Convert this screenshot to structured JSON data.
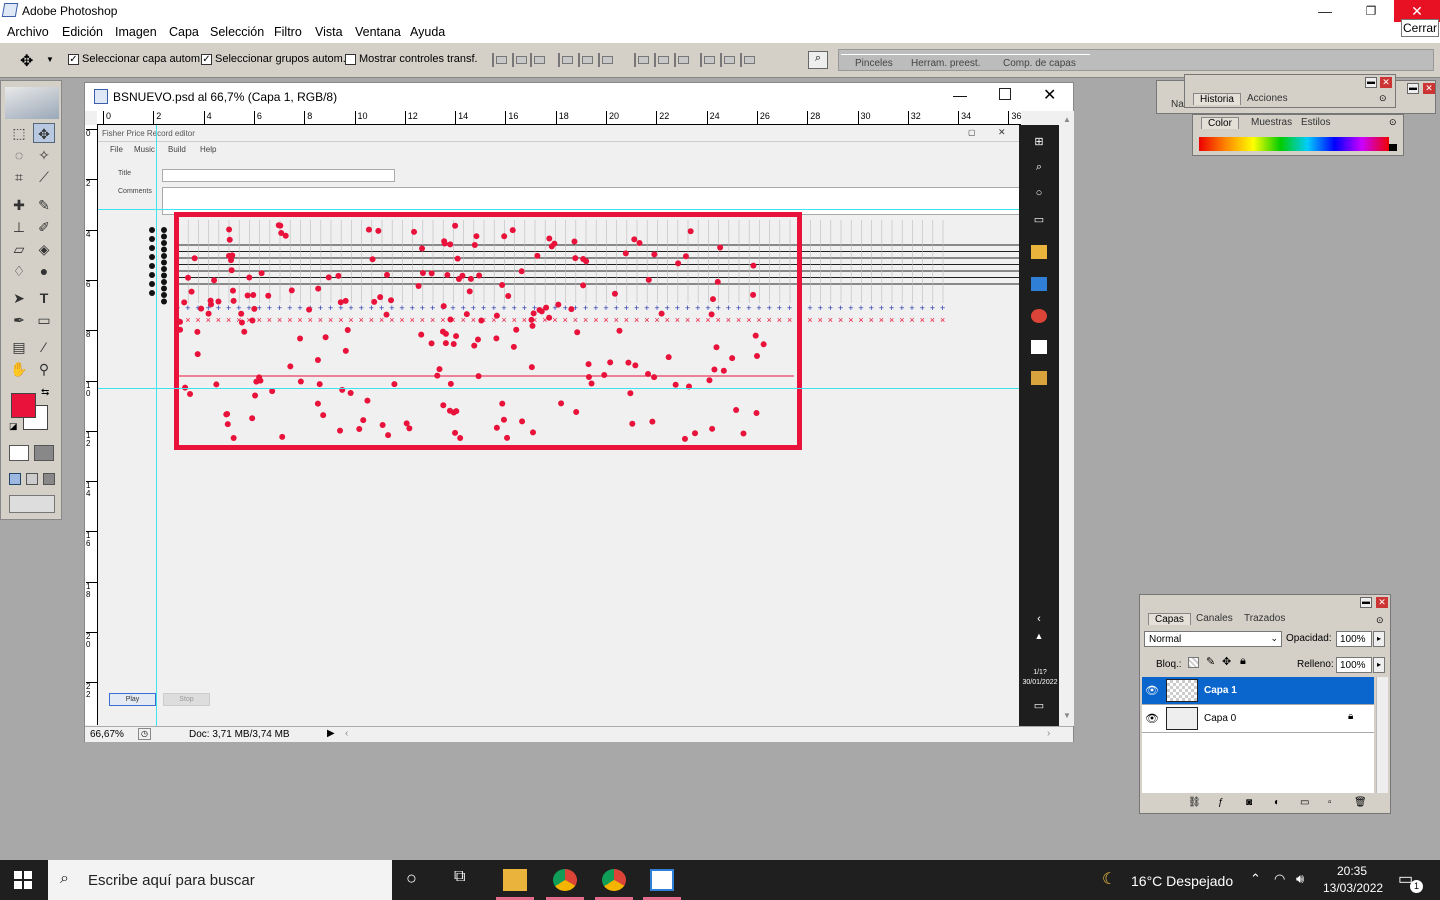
{
  "app": {
    "title": "Adobe Photoshop",
    "close_tooltip": "Cerrar",
    "minimize": "—",
    "restore": "❐",
    "close": "✕"
  },
  "menu": [
    "Archivo",
    "Edición",
    "Imagen",
    "Capa",
    "Selección",
    "Filtro",
    "Vista",
    "Ventana",
    "Ayuda"
  ],
  "options": {
    "auto_layer": "Seleccionar capa autom.",
    "auto_groups": "Seleccionar grupos autom.",
    "show_transform": "Mostrar controles transf.",
    "auto_layer_checked": "✓",
    "auto_groups_checked": "✓"
  },
  "wells": [
    "Pinceles",
    "Herram. preest.",
    "Comp. de capas"
  ],
  "document": {
    "title": "BSNUEVO.psd al 66,7% (Capa 1, RGB/8)",
    "zoom": "66,67%",
    "doc_size": "Doc: 3,71 MB/3,74 MB",
    "ruler_top": [
      "0",
      "2",
      "4",
      "6",
      "8",
      "10",
      "12",
      "14",
      "16",
      "18",
      "20",
      "22",
      "24",
      "26",
      "28",
      "30",
      "32",
      "34",
      "36"
    ],
    "ruler_left": [
      "0",
      "2",
      "4",
      "6",
      "8",
      "1\n0",
      "1\n2",
      "1\n4",
      "1\n6",
      "1\n8",
      "2\n0",
      "2\n2"
    ]
  },
  "inner_app": {
    "title": "Fisher Price Record editor",
    "menu": [
      "File",
      "Music",
      "Build",
      "Help"
    ],
    "title_label": "Title",
    "comments_label": "Comments",
    "play_button": "Play",
    "stop_button": "Stop",
    "clock": "1/1?\n30/01/2022"
  },
  "panels": {
    "history_tabs": [
      "Historia",
      "Acciones"
    ],
    "navigator_tab": "Na",
    "color_tabs": [
      "Color",
      "Muestras",
      "Estilos"
    ],
    "layers_tabs": [
      "Capas",
      "Canales",
      "Trazados"
    ],
    "blend_mode": "Normal",
    "opacity_label": "Opacidad:",
    "opacity_value": "100%",
    "lock_label": "Bloq.:",
    "fill_label": "Relleno:",
    "fill_value": "100%",
    "layers": [
      {
        "name": "Capa 1",
        "selected": true
      },
      {
        "name": "Capa 0",
        "selected": false,
        "locked": true
      }
    ]
  },
  "taskbar": {
    "search_placeholder": "Escribe aquí para buscar",
    "weather": "16°C  Despejado",
    "time": "20:35",
    "date": "13/03/2022",
    "notification_count": "1"
  },
  "colors": {
    "foreground": "#e8123a",
    "background": "#ffffff",
    "accent": "#0a66cc",
    "annotation": "#e8123a"
  }
}
